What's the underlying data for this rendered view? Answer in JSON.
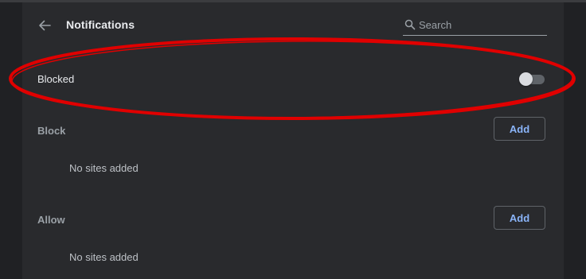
{
  "header": {
    "title": "Notifications",
    "back_icon": "arrow-left-icon"
  },
  "search": {
    "placeholder": "Search",
    "value": "",
    "icon": "search-icon"
  },
  "blocked_row": {
    "label": "Blocked",
    "toggle_on": false
  },
  "sections": {
    "block": {
      "label": "Block",
      "add_label": "Add",
      "empty_text": "No sites added"
    },
    "allow": {
      "label": "Allow",
      "add_label": "Add",
      "empty_text": "No sites added"
    }
  },
  "colors": {
    "background": "#202124",
    "panel": "#292a2d",
    "text_primary": "#e8eaed",
    "text_secondary": "#9aa0a6",
    "accent": "#8ab4f8",
    "annotation_red": "#e00000"
  }
}
